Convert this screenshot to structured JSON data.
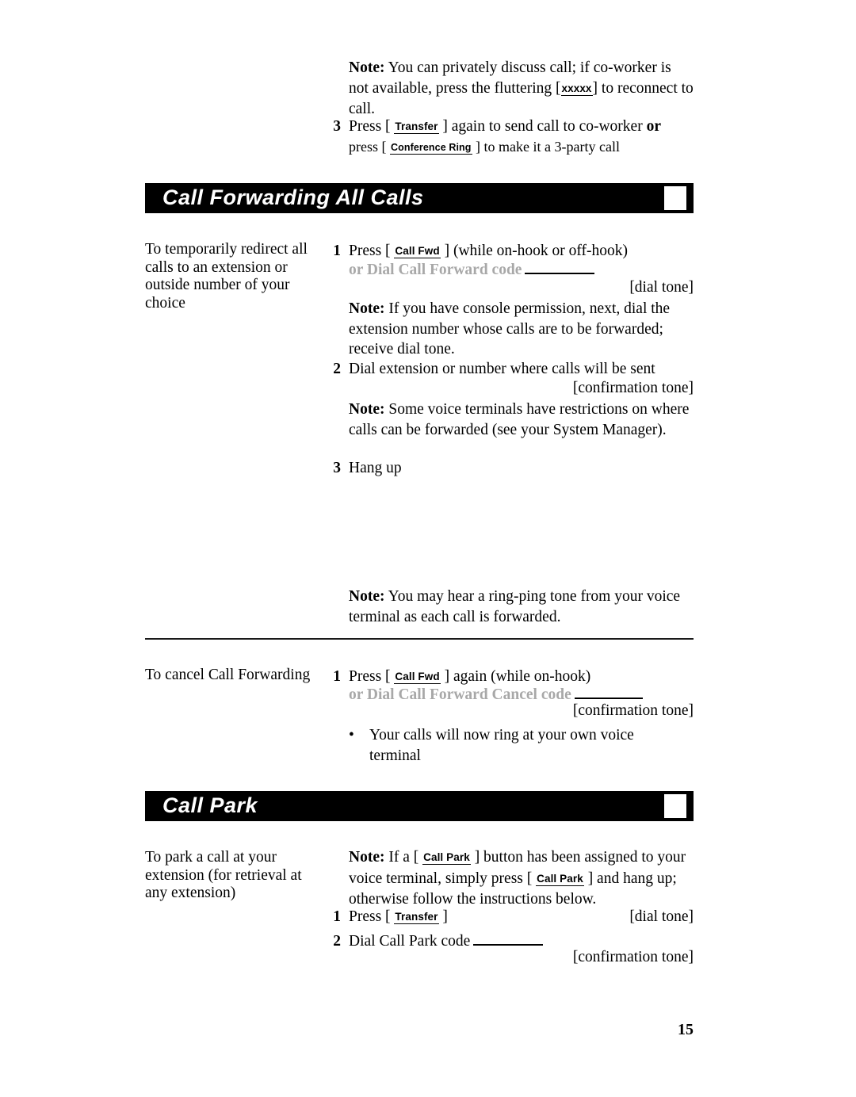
{
  "page": {
    "number": "15"
  },
  "top_section": {
    "note": {
      "label": "Note:",
      "text_1": "You can privately discuss call; if co-worker is not available, press the fluttering [",
      "button": "xxxxx",
      "text_2": "] to reconnect to call."
    },
    "step": {
      "num": "3",
      "text_1": "Press [",
      "button_1": "Transfer",
      "text_2": "] again to send call to co-worker",
      "bold_or": "or",
      "sub_text_1": "press [",
      "button_2": "Conference  Ring",
      "sub_text_2": "] to make it a 3-party call"
    }
  },
  "sections": [
    {
      "title": "Call  Forwarding  All  Calls",
      "square_icon": "white-square-icon"
    },
    {
      "title": "Call  Park",
      "square_icon": "white-square-icon"
    }
  ],
  "call_forwarding": {
    "task_label": "To temporarily redirect all calls to an extension or outside number of your choice",
    "step1": {
      "num": "1",
      "text_1": "Press [",
      "button": "Call Fwd",
      "text_2": "] (while on-hook or off-hook)",
      "alt_line": "or Dial Call Forward code",
      "tone": "[dial  tone]"
    },
    "note1": {
      "label": "Note:",
      "text": "If you have console permission, next, dial the extension number whose calls are to be forwarded; receive  dial  tone."
    },
    "step2": {
      "num": "2",
      "text": "Dial extension or number where calls will be sent",
      "tone": "[confirmation tone]"
    },
    "note2": {
      "label": "Note:",
      "text": "Some voice terminals have restrictions on where  calls  can  be  forwarded  (see  your  System Manager)."
    },
    "step3": {
      "num": "3",
      "text": "Hang up"
    },
    "note3": {
      "label": "Note:",
      "text": "You may hear a ring-ping tone from your voice terminal as each call is forwarded."
    }
  },
  "call_forwarding_cancel": {
    "task_label": "To cancel Call Forwarding",
    "step1": {
      "num": "1",
      "text_1": "Press [",
      "button": "Call Fwd",
      "text_2": "] again (while on-hook)",
      "alt_line": "or Dial Call Forward Cancel code",
      "tone": "[confirmation tone]"
    },
    "bullet": {
      "marker": "•",
      "text": "Your calls will now ring at your own voice terminal"
    }
  },
  "call_park": {
    "task_label": "To park a call at your extension (for retrieval at any extension)",
    "note": {
      "label": "Note:",
      "text_1": "If a [",
      "button_1": "Call Park",
      "text_2": "] button has been assigned to your voice terminal, simply press [",
      "button_2": "Call Park",
      "text_3": "] and hang up; otherwise follow the instructions below."
    },
    "step1": {
      "num": "1",
      "text_1": "Press [",
      "button": "Transfer",
      "text_2": "]",
      "tone": "[dial  tone]"
    },
    "step2": {
      "num": "2",
      "text": "Dial Call Park code",
      "tone": "[confirmation  tone]"
    }
  }
}
